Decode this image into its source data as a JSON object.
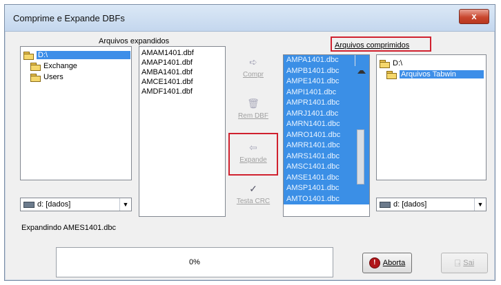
{
  "window": {
    "title": "Comprime e Expande DBFs",
    "close_label": "x"
  },
  "left": {
    "header": "Arquivos expandidos",
    "tree": [
      {
        "label": "D:\\",
        "selected": true
      },
      {
        "label": "Exchange"
      },
      {
        "label": "Users"
      }
    ],
    "files": [
      "AMAM1401.dbf",
      "AMAP1401.dbf",
      "AMBA1401.dbf",
      "AMCE1401.dbf",
      "AMDF1401.dbf"
    ],
    "drive_combo": "d: [dados]"
  },
  "middle": {
    "buttons": [
      {
        "label": "Compr",
        "icon": "arrow-right-icon"
      },
      {
        "label": "Rem DBF",
        "icon": "trash-icon"
      },
      {
        "label": "Expande",
        "icon": "arrow-left-icon"
      },
      {
        "label": "Testa CRC",
        "icon": "check-icon"
      }
    ]
  },
  "right": {
    "header": "Arquivos comprimidos",
    "files": [
      "AMPA1401.dbc",
      "AMPB1401.dbc",
      "AMPE1401.dbc",
      "AMPI1401.dbc",
      "AMPR1401.dbc",
      "AMRJ1401.dbc",
      "AMRN1401.dbc",
      "AMRO1401.dbc",
      "AMRR1401.dbc",
      "AMRS1401.dbc",
      "AMSC1401.dbc",
      "AMSE1401.dbc",
      "AMSP1401.dbc",
      "AMTO1401.dbc"
    ],
    "tree": [
      {
        "label": "D:\\"
      },
      {
        "label": "Arquivos Tabwin",
        "selected": true
      }
    ],
    "drive_combo": "d: [dados]"
  },
  "status": {
    "text": "Expandindo AMES1401.dbc"
  },
  "progress": {
    "text": "0%",
    "value": 0
  },
  "actions": {
    "aborta_label": "Aborta",
    "sai_label": "Sai"
  },
  "colors": {
    "selection": "#3d8ee8",
    "highlight": "#d0202e"
  }
}
